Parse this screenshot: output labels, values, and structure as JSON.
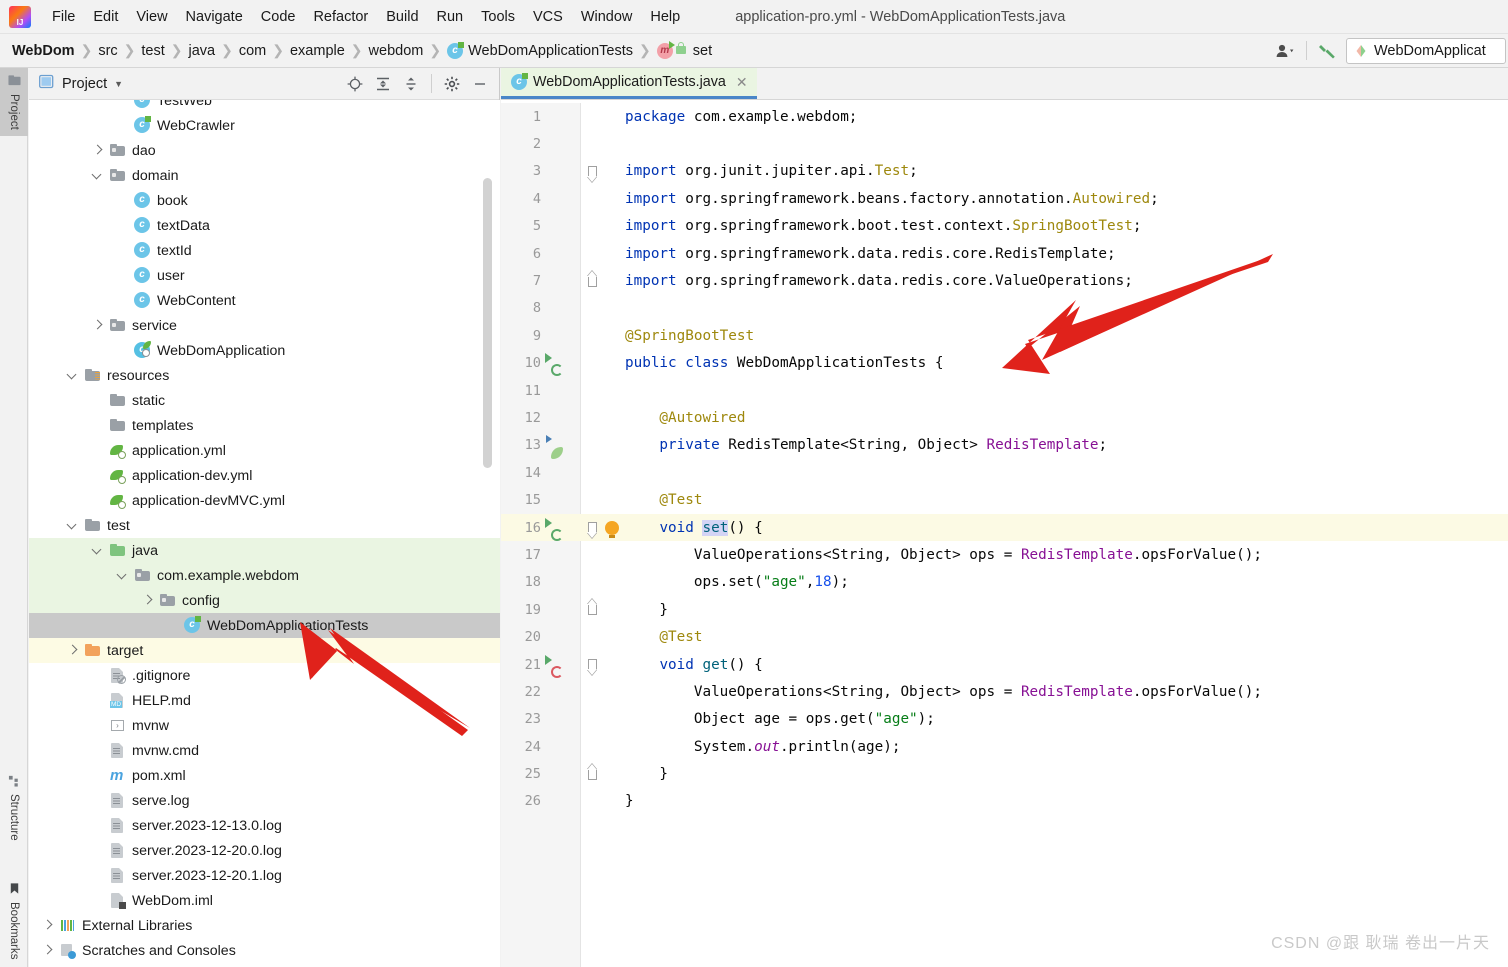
{
  "window": {
    "title": "application-pro.yml - WebDomApplicationTests.java"
  },
  "menubar": {
    "items": [
      "File",
      "Edit",
      "View",
      "Navigate",
      "Code",
      "Refactor",
      "Build",
      "Run",
      "Tools",
      "VCS",
      "Window",
      "Help"
    ]
  },
  "navbar": {
    "crumbs": [
      {
        "label": "WebDom",
        "icon": null
      },
      {
        "label": "src",
        "icon": null
      },
      {
        "label": "test",
        "icon": null
      },
      {
        "label": "java",
        "icon": null
      },
      {
        "label": "com",
        "icon": null
      },
      {
        "label": "example",
        "icon": null
      },
      {
        "label": "webdom",
        "icon": null
      },
      {
        "label": "WebDomApplicationTests",
        "icon": "class-icon"
      },
      {
        "label": "set",
        "icon": "method-icon"
      }
    ],
    "account_icon": "user-account-icon",
    "build_icon": "hammer-build-icon",
    "run_config": "WebDomApplicat"
  },
  "toolstrip": {
    "tabs": [
      {
        "label": "Project",
        "icon": "project-folder-icon",
        "active": true
      },
      {
        "label": "Structure",
        "icon": "structure-icon",
        "active": false
      },
      {
        "label": "Bookmarks",
        "icon": "bookmark-icon",
        "active": false
      }
    ]
  },
  "project_panel": {
    "title": "Project",
    "dropdown_icon": "chevron-down-icon",
    "toolbar_icons": [
      "locate-target-icon",
      "expand-all-icon",
      "collapse-all-icon",
      "gear-icon",
      "minimize-icon"
    ],
    "tree": [
      {
        "label": "TestWeb",
        "depth": 3,
        "icon": "class-icon",
        "arrow": null,
        "state": "clipped"
      },
      {
        "label": "WebCrawler",
        "depth": 3,
        "icon": "class-icon-green",
        "arrow": null,
        "state": "normal"
      },
      {
        "label": "dao",
        "depth": 2,
        "icon": "folder-package",
        "arrow": "right",
        "state": "normal"
      },
      {
        "label": "domain",
        "depth": 2,
        "icon": "folder-package",
        "arrow": "down",
        "state": "normal"
      },
      {
        "label": "book",
        "depth": 3,
        "icon": "class-icon",
        "arrow": null,
        "state": "normal"
      },
      {
        "label": "textData",
        "depth": 3,
        "icon": "class-icon",
        "arrow": null,
        "state": "normal"
      },
      {
        "label": "textId",
        "depth": 3,
        "icon": "class-icon",
        "arrow": null,
        "state": "normal"
      },
      {
        "label": "user",
        "depth": 3,
        "icon": "class-icon",
        "arrow": null,
        "state": "normal"
      },
      {
        "label": "WebContent",
        "depth": 3,
        "icon": "class-icon",
        "arrow": null,
        "state": "normal"
      },
      {
        "label": "service",
        "depth": 2,
        "icon": "folder-package",
        "arrow": "right",
        "state": "normal"
      },
      {
        "label": "WebDomApplication",
        "depth": 3,
        "icon": "spring-boot-class-icon",
        "arrow": null,
        "state": "normal"
      },
      {
        "label": "resources",
        "depth": 1,
        "icon": "folder-resources",
        "arrow": "down",
        "state": "normal"
      },
      {
        "label": "static",
        "depth": 2,
        "icon": "folder-plain",
        "arrow": null,
        "state": "normal"
      },
      {
        "label": "templates",
        "depth": 2,
        "icon": "folder-plain",
        "arrow": null,
        "state": "normal"
      },
      {
        "label": "application.yml",
        "depth": 2,
        "icon": "yaml-spring-icon",
        "arrow": null,
        "state": "normal"
      },
      {
        "label": "application-dev.yml",
        "depth": 2,
        "icon": "yaml-spring-icon",
        "arrow": null,
        "state": "normal"
      },
      {
        "label": "application-devMVC.yml",
        "depth": 2,
        "icon": "yaml-spring-icon",
        "arrow": null,
        "state": "normal"
      },
      {
        "label": "test",
        "depth": 1,
        "icon": "folder-plain",
        "arrow": "down",
        "state": "normal"
      },
      {
        "label": "java",
        "depth": 2,
        "icon": "folder-test-source",
        "arrow": "down",
        "state": "green"
      },
      {
        "label": "com.example.webdom",
        "depth": 3,
        "icon": "folder-package",
        "arrow": "down",
        "state": "green"
      },
      {
        "label": "config",
        "depth": 4,
        "icon": "folder-package",
        "arrow": "right",
        "state": "green"
      },
      {
        "label": "WebDomApplicationTests",
        "depth": 5,
        "icon": "class-icon-green",
        "arrow": null,
        "state": "selected"
      },
      {
        "label": "target",
        "depth": 1,
        "icon": "folder-excluded",
        "arrow": "right",
        "state": "yellow"
      },
      {
        "label": ".gitignore",
        "depth": 2,
        "icon": "gitignore-icon",
        "arrow": null,
        "state": "normal"
      },
      {
        "label": "HELP.md",
        "depth": 2,
        "icon": "markdown-icon",
        "arrow": null,
        "state": "normal"
      },
      {
        "label": "mvnw",
        "depth": 2,
        "icon": "script-icon",
        "arrow": null,
        "state": "normal"
      },
      {
        "label": "mvnw.cmd",
        "depth": 2,
        "icon": "text-file-icon",
        "arrow": null,
        "state": "normal"
      },
      {
        "label": "pom.xml",
        "depth": 2,
        "icon": "maven-icon",
        "arrow": null,
        "state": "normal"
      },
      {
        "label": "serve.log",
        "depth": 2,
        "icon": "text-file-icon",
        "arrow": null,
        "state": "normal"
      },
      {
        "label": "server.2023-12-13.0.log",
        "depth": 2,
        "icon": "text-file-icon",
        "arrow": null,
        "state": "normal"
      },
      {
        "label": "server.2023-12-20.0.log",
        "depth": 2,
        "icon": "text-file-icon",
        "arrow": null,
        "state": "normal"
      },
      {
        "label": "server.2023-12-20.1.log",
        "depth": 2,
        "icon": "text-file-icon",
        "arrow": null,
        "state": "normal"
      },
      {
        "label": "WebDom.iml",
        "depth": 2,
        "icon": "iml-icon",
        "arrow": null,
        "state": "normal"
      },
      {
        "label": "External Libraries",
        "depth": 0,
        "icon": "libraries-icon",
        "arrow": "right",
        "state": "normal"
      },
      {
        "label": "Scratches and Consoles",
        "depth": 0,
        "icon": "scratches-icon",
        "arrow": "right",
        "state": "normal"
      }
    ]
  },
  "editor": {
    "tab": {
      "label": "WebDomApplicationTests.java",
      "icon": "class-icon-green",
      "close_icon": "close-icon"
    },
    "lines": [
      {
        "n": "1",
        "gutter": null,
        "fold": null,
        "highlight": false,
        "tokens": [
          {
            "t": "package ",
            "c": "kw"
          },
          {
            "t": "com.example.webdom;",
            "c": "plain"
          }
        ]
      },
      {
        "n": "2",
        "gutter": null,
        "fold": null,
        "highlight": false,
        "tokens": []
      },
      {
        "n": "3",
        "gutter": null,
        "fold": "down",
        "highlight": false,
        "tokens": [
          {
            "t": "import ",
            "c": "kw"
          },
          {
            "t": "org.junit.jupiter.api.",
            "c": "plain"
          },
          {
            "t": "Test",
            "c": "ann"
          },
          {
            "t": ";",
            "c": "plain"
          }
        ]
      },
      {
        "n": "4",
        "gutter": null,
        "fold": null,
        "highlight": false,
        "tokens": [
          {
            "t": "import ",
            "c": "kw"
          },
          {
            "t": "org.springframework.beans.factory.annotation.",
            "c": "plain"
          },
          {
            "t": "Autowired",
            "c": "ann"
          },
          {
            "t": ";",
            "c": "plain"
          }
        ]
      },
      {
        "n": "5",
        "gutter": null,
        "fold": null,
        "highlight": false,
        "tokens": [
          {
            "t": "import ",
            "c": "kw"
          },
          {
            "t": "org.springframework.boot.test.context.",
            "c": "plain"
          },
          {
            "t": "SpringBootTest",
            "c": "ann"
          },
          {
            "t": ";",
            "c": "plain"
          }
        ]
      },
      {
        "n": "6",
        "gutter": null,
        "fold": null,
        "highlight": false,
        "tokens": [
          {
            "t": "import ",
            "c": "kw"
          },
          {
            "t": "org.springframework.data.redis.core.RedisTemplate;",
            "c": "plain"
          }
        ]
      },
      {
        "n": "7",
        "gutter": null,
        "fold": "up",
        "highlight": false,
        "tokens": [
          {
            "t": "import ",
            "c": "kw"
          },
          {
            "t": "org.springframework.data.redis.core.ValueOperations;",
            "c": "plain"
          }
        ]
      },
      {
        "n": "8",
        "gutter": null,
        "fold": null,
        "highlight": false,
        "tokens": []
      },
      {
        "n": "9",
        "gutter": "spring-bean-leaf-icon",
        "fold": null,
        "highlight": false,
        "tokens": [
          {
            "t": "@SpringBootTest",
            "c": "ann"
          }
        ]
      },
      {
        "n": "10",
        "gutter": "run-test-icon",
        "fold": null,
        "highlight": false,
        "tokens": [
          {
            "t": "public ",
            "c": "kw"
          },
          {
            "t": "class ",
            "c": "kw"
          },
          {
            "t": "WebDomApplicationTests ",
            "c": "plain"
          },
          {
            "t": "{",
            "c": "plain"
          }
        ]
      },
      {
        "n": "11",
        "gutter": null,
        "fold": null,
        "highlight": false,
        "tokens": []
      },
      {
        "n": "12",
        "gutter": null,
        "fold": null,
        "highlight": false,
        "tokens": [
          {
            "t": "    @Autowired",
            "c": "ann"
          }
        ]
      },
      {
        "n": "13",
        "gutter": "bean-autowire-icon",
        "fold": null,
        "highlight": false,
        "tokens": [
          {
            "t": "    private ",
            "c": "kw"
          },
          {
            "t": "RedisTemplate<String, Object> ",
            "c": "plain"
          },
          {
            "t": "RedisTemplate",
            "c": "fld"
          },
          {
            "t": ";",
            "c": "plain"
          }
        ]
      },
      {
        "n": "14",
        "gutter": null,
        "fold": null,
        "highlight": false,
        "tokens": []
      },
      {
        "n": "15",
        "gutter": null,
        "fold": null,
        "highlight": false,
        "tokens": [
          {
            "t": "    @Test",
            "c": "ann"
          }
        ]
      },
      {
        "n": "16",
        "gutter": "run-test-icon",
        "fold": "down",
        "highlight": true,
        "bulb": true,
        "tokens": [
          {
            "t": "    ",
            "c": "plain"
          },
          {
            "t": "void ",
            "c": "kw"
          },
          {
            "t": "set",
            "c": "mtd selhl"
          },
          {
            "t": "() {",
            "c": "plain"
          }
        ]
      },
      {
        "n": "17",
        "gutter": null,
        "fold": null,
        "highlight": false,
        "tokens": [
          {
            "t": "        ValueOperations<String, Object> ops = ",
            "c": "plain"
          },
          {
            "t": "RedisTemplate",
            "c": "fld"
          },
          {
            "t": ".opsForValue();",
            "c": "plain"
          }
        ]
      },
      {
        "n": "18",
        "gutter": null,
        "fold": null,
        "highlight": false,
        "tokens": [
          {
            "t": "        ops.set(",
            "c": "plain"
          },
          {
            "t": "\"age\"",
            "c": "str"
          },
          {
            "t": ",",
            "c": "plain"
          },
          {
            "t": "18",
            "c": "num"
          },
          {
            "t": ");",
            "c": "plain"
          }
        ]
      },
      {
        "n": "19",
        "gutter": null,
        "fold": "up",
        "highlight": false,
        "tokens": [
          {
            "t": "    }",
            "c": "plain"
          }
        ]
      },
      {
        "n": "20",
        "gutter": null,
        "fold": null,
        "highlight": false,
        "tokens": [
          {
            "t": "    @Test",
            "c": "ann"
          }
        ]
      },
      {
        "n": "21",
        "gutter": "run-test-error-icon",
        "fold": "down",
        "highlight": false,
        "tokens": [
          {
            "t": "    ",
            "c": "plain"
          },
          {
            "t": "void ",
            "c": "kw"
          },
          {
            "t": "get",
            "c": "mtd"
          },
          {
            "t": "() {",
            "c": "plain"
          }
        ]
      },
      {
        "n": "22",
        "gutter": null,
        "fold": null,
        "highlight": false,
        "tokens": [
          {
            "t": "        ValueOperations<String, Object> ops = ",
            "c": "plain"
          },
          {
            "t": "RedisTemplate",
            "c": "fld"
          },
          {
            "t": ".opsForValue();",
            "c": "plain"
          }
        ]
      },
      {
        "n": "23",
        "gutter": null,
        "fold": null,
        "highlight": false,
        "tokens": [
          {
            "t": "        Object age = ops.get(",
            "c": "plain"
          },
          {
            "t": "\"age\"",
            "c": "str"
          },
          {
            "t": ");",
            "c": "plain"
          }
        ]
      },
      {
        "n": "24",
        "gutter": null,
        "fold": null,
        "highlight": false,
        "tokens": [
          {
            "t": "        System.",
            "c": "plain"
          },
          {
            "t": "out",
            "c": "stc"
          },
          {
            "t": ".println(age);",
            "c": "plain"
          }
        ]
      },
      {
        "n": "25",
        "gutter": null,
        "fold": "up",
        "highlight": false,
        "tokens": [
          {
            "t": "    }",
            "c": "plain"
          }
        ]
      },
      {
        "n": "26",
        "gutter": null,
        "fold": null,
        "highlight": false,
        "tokens": [
          {
            "t": "}",
            "c": "plain"
          }
        ]
      }
    ]
  },
  "annotations": {
    "arrows": [
      {
        "name": "arrow-pointing-to-class-declaration",
        "color": "#e0221b"
      },
      {
        "name": "arrow-pointing-to-test-file-in-tree",
        "color": "#e0221b"
      }
    ]
  },
  "watermark": {
    "text": "CSDN @跟 耿瑞 卷出一片天"
  }
}
